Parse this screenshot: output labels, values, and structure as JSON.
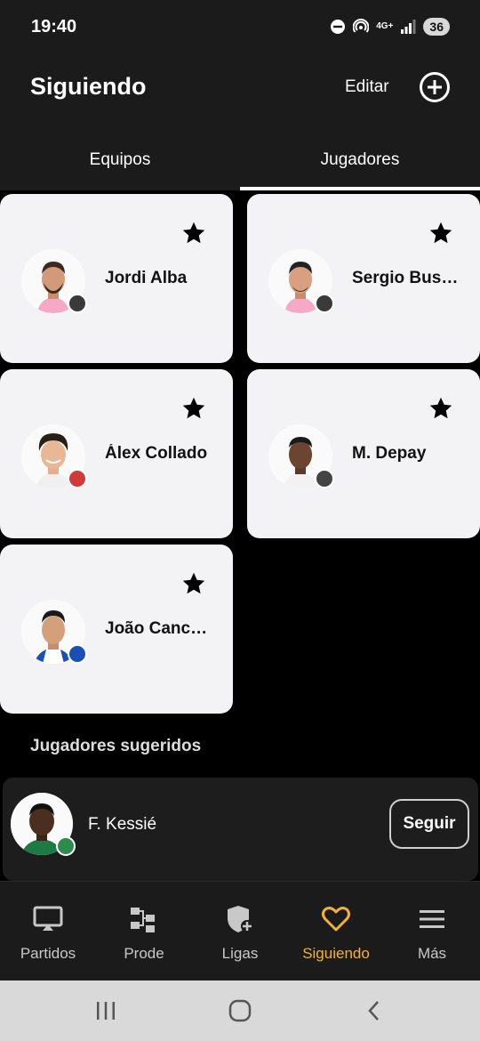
{
  "status": {
    "time": "19:40",
    "network": "4G+",
    "battery": "36"
  },
  "header": {
    "title": "Siguiendo",
    "edit_label": "Editar",
    "add_icon": "plus-circle-icon"
  },
  "tabs": [
    {
      "label": "Equipos",
      "active": false
    },
    {
      "label": "Jugadores",
      "active": true
    }
  ],
  "players": [
    {
      "name": "Jordi Alba",
      "badge_color": "#3a3a3a",
      "favorite": true
    },
    {
      "name": "Sergio Busquets",
      "badge_color": "#3a3a3a",
      "favorite": true
    },
    {
      "name": "Álex Collado",
      "badge_color": "#d23a3a",
      "favorite": true
    },
    {
      "name": "M. Depay",
      "badge_color": "#444444",
      "favorite": true
    },
    {
      "name": "João Cancelo",
      "badge_color": "#1a4fb5",
      "favorite": true
    }
  ],
  "suggested": {
    "title": "Jugadores sugeridos",
    "items": [
      {
        "name": "F. Kessié",
        "follow_label": "Seguir",
        "badge_color": "#2e8b4f"
      }
    ]
  },
  "bottom_nav": [
    {
      "label": "Partidos",
      "icon": "tv-icon",
      "active": false
    },
    {
      "label": "Prode",
      "icon": "bracket-icon",
      "active": false
    },
    {
      "label": "Ligas",
      "icon": "shield-plus-icon",
      "active": false
    },
    {
      "label": "Siguiendo",
      "icon": "heart-icon",
      "active": true
    },
    {
      "label": "Más",
      "icon": "menu-icon",
      "active": false
    }
  ],
  "colors": {
    "accent": "#f2b234",
    "card_bg": "#f3f3f6",
    "bar_bg": "#1b1b1b"
  }
}
